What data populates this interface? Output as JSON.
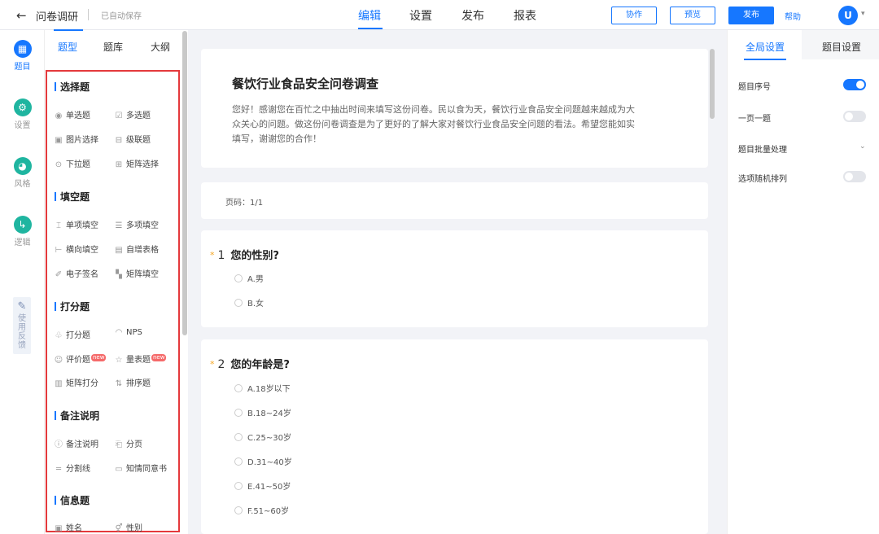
{
  "header": {
    "back_icon": "arrow-left-icon",
    "title": "问卷调研",
    "autosave": "已自动保存",
    "tabs": [
      "编辑",
      "设置",
      "发布",
      "报表"
    ],
    "active_tab": "编辑",
    "collab_label": "协作",
    "preview_label": "预览",
    "publish_label": "发布",
    "help_label": "帮助",
    "avatar_text": "U"
  },
  "rail": {
    "items": [
      {
        "label": "题目",
        "icon": "grid-icon",
        "active": true
      },
      {
        "label": "设置",
        "icon": "settings-icon",
        "active": false
      },
      {
        "label": "风格",
        "icon": "palette-icon",
        "active": false
      },
      {
        "label": "逻辑",
        "icon": "logic-icon",
        "active": false
      }
    ],
    "feedback_label": "使用反馈"
  },
  "panel": {
    "tabs": [
      "题型",
      "题库",
      "大纲"
    ],
    "active_tab": "题型",
    "sections": [
      {
        "title": "选择题",
        "items": [
          "单选题",
          "多选题",
          "图片选择",
          "级联题",
          "下拉题",
          "矩阵选择"
        ]
      },
      {
        "title": "填空题",
        "items": [
          "单项填空",
          "多项填空",
          "横向填空",
          "自增表格",
          "电子签名",
          "矩阵填空"
        ]
      },
      {
        "title": "打分题",
        "items": [
          "打分题",
          "NPS",
          "评价题",
          "量表题",
          "矩阵打分",
          "排序题"
        ]
      },
      {
        "title": "备注说明",
        "items": [
          "备注说明",
          "分页",
          "分割线",
          "知情同意书"
        ]
      },
      {
        "title": "信息题",
        "items": [
          "姓名",
          "性别"
        ]
      }
    ],
    "new_badge": "new"
  },
  "survey": {
    "title": "餐饮行业食品安全问卷调查",
    "description": "您好！感谢您在百忙之中抽出时间来填写这份问卷。民以食为天，餐饮行业食品安全问题越来越成为大众关心的问题。做这份问卷调查是为了更好的了解大家对餐饮行业食品安全问题的看法。希望您能如实填写，谢谢您的合作！",
    "page_label": "页码：1/1",
    "questions": [
      {
        "num": "1",
        "title": "您的性别?",
        "options": [
          "A.男",
          "B.女"
        ]
      },
      {
        "num": "2",
        "title": "您的年龄是?",
        "options": [
          "A.18岁以下",
          "B.18~24岁",
          "C.25~30岁",
          "D.31~40岁",
          "E.41~50岁",
          "F.51~60岁"
        ]
      }
    ]
  },
  "settings": {
    "tabs": [
      "全局设置",
      "题目设置"
    ],
    "active_tab": "全局设置",
    "rows": [
      {
        "label": "题目序号",
        "type": "toggle",
        "on": true
      },
      {
        "label": "一页一题",
        "type": "toggle",
        "on": false
      },
      {
        "label": "题目批量处理",
        "type": "dropdown"
      },
      {
        "label": "选项随机排列",
        "type": "toggle",
        "on": false
      }
    ]
  },
  "colors": {
    "accent": "#1677ff",
    "highlight_border": "#e4393c",
    "required_star": "#f5a623",
    "toggle_off": "#e3e5ea"
  }
}
